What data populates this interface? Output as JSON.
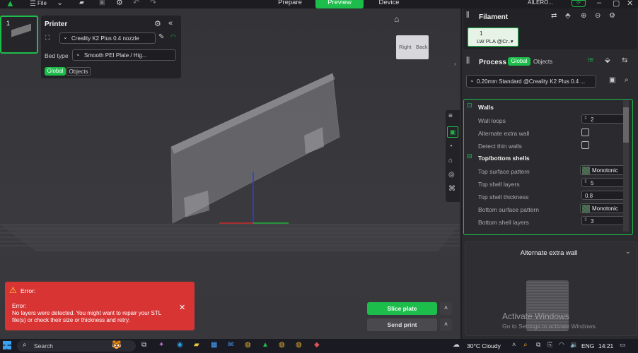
{
  "topbar": {
    "file": "File",
    "tabs": [
      "Prepare",
      "Preview",
      "Device"
    ],
    "user": "AILERO..."
  },
  "plate": {
    "number": "1"
  },
  "printer": {
    "title": "Printer",
    "printer_name": "Creality K2 Plus 0.4 nozzle",
    "bed_type_label": "Bed type",
    "bed_type_value": "Smooth PEI Plate / Hig...",
    "scope_global": "Global",
    "scope_objects": "Objects"
  },
  "view": {
    "right": "Right",
    "back": "Back"
  },
  "filament": {
    "title": "Filament",
    "slot_number": "1",
    "slot_label": "LW PLA @Cr..▾",
    "slot_color": "#e8f3e8"
  },
  "process": {
    "title": "Process",
    "scope_global": "Global",
    "scope_objects": "Objects",
    "profile": "0.20mm Standard @Creality K2 Plus 0.4 ...",
    "sections": [
      {
        "title": "Walls"
      },
      {
        "title": "Top/bottom shells"
      }
    ],
    "settings": [
      {
        "label": "Wall loops",
        "value": "2",
        "type": "spin"
      },
      {
        "label": "Alternate extra wall",
        "value": "",
        "type": "check"
      },
      {
        "label": "Detect thin walls",
        "value": "",
        "type": "check"
      },
      {
        "label": "Top surface pattern",
        "value": "Monotonic",
        "type": "pattern"
      },
      {
        "label": "Top shell layers",
        "value": "5",
        "type": "spin"
      },
      {
        "label": "Top shell thickness",
        "value": "0.8",
        "type": "text"
      },
      {
        "label": "Bottom surface pattern",
        "value": "Monotonic",
        "type": "pattern"
      },
      {
        "label": "Bottom shell layers",
        "value": "3",
        "type": "spin"
      }
    ]
  },
  "help": {
    "title": "Alternate extra wall"
  },
  "watermark": {
    "line1": "Activate Windows",
    "line2": "Go to Settings to activate Windows."
  },
  "error": {
    "title": "Error:",
    "heading": "Error:",
    "message": "No layers were detected. You might want to repair your STL file(s) or check their size or thickness and retry."
  },
  "actions": {
    "slice": "Slice plate",
    "send": "Send print"
  },
  "taskbar": {
    "search": "Search",
    "weather": "30°C  Cloudy",
    "lang": "ENG",
    "time": "14:21"
  },
  "colors": {
    "accent": "#1dbd4c",
    "error": "#d93434"
  }
}
